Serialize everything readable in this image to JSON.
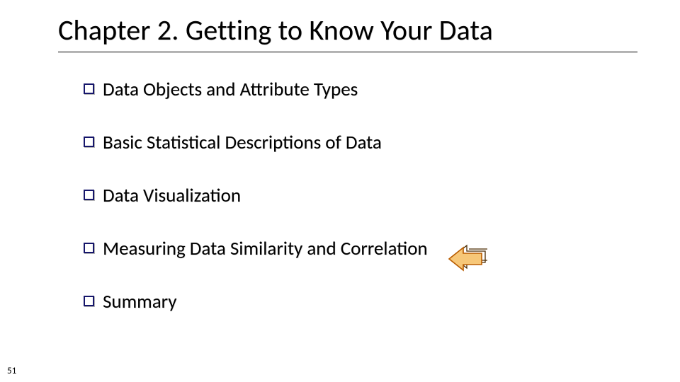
{
  "title": "Chapter 2.  Getting to Know Your Data",
  "bullets": [
    "Data Objects and Attribute Types",
    "Basic Statistical Descriptions of Data",
    "Data Visualization",
    "Measuring Data Similarity and Correlation",
    "Summary"
  ],
  "page_number": "51",
  "highlight_index": 3,
  "colors": {
    "bullet_border": "#16166b",
    "arrow_fill": "#f7c778",
    "arrow_stroke": "#b85c00"
  }
}
